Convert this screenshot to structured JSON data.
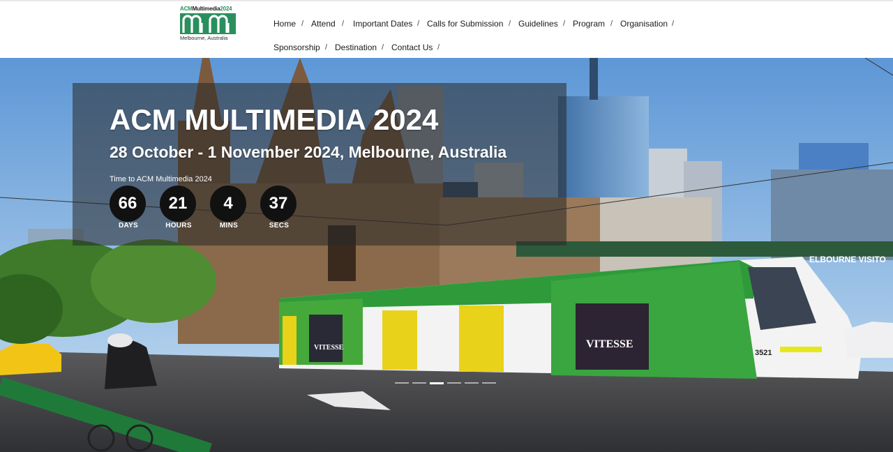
{
  "logo": {
    "top_prefix": "ACM",
    "top_main": "Multimedia",
    "top_year": "2024",
    "mark": "mm",
    "subtitle": "Melbourne, Australia"
  },
  "nav": {
    "row1": [
      "Home",
      "Attend",
      "Important Dates",
      "Calls for Submission",
      "Guidelines",
      "Program",
      "Organisation"
    ],
    "row2": [
      "Sponsorship",
      "Destination",
      "Contact Us"
    ],
    "separator": "/"
  },
  "hero": {
    "title": "ACM MULTIMEDIA 2024",
    "subtitle": "28 October - 1 November 2024, Melbourne, Australia",
    "countdown_label": "Time to ACM Multimedia 2024",
    "countdown": [
      {
        "value": "66",
        "unit": "DAYS"
      },
      {
        "value": "21",
        "unit": "HOURS"
      },
      {
        "value": "4",
        "unit": "MINS"
      },
      {
        "value": "37",
        "unit": "SECS"
      }
    ],
    "tram_number": "3521",
    "tram_ad": "VITESSE",
    "tram_ad_small": "VITESSE",
    "sign_text": "ELBOURNE VISITO",
    "slides": 6,
    "active_slide": 2
  },
  "colors": {
    "brand_green": "#2a8f5d",
    "overlay": "#282828"
  }
}
